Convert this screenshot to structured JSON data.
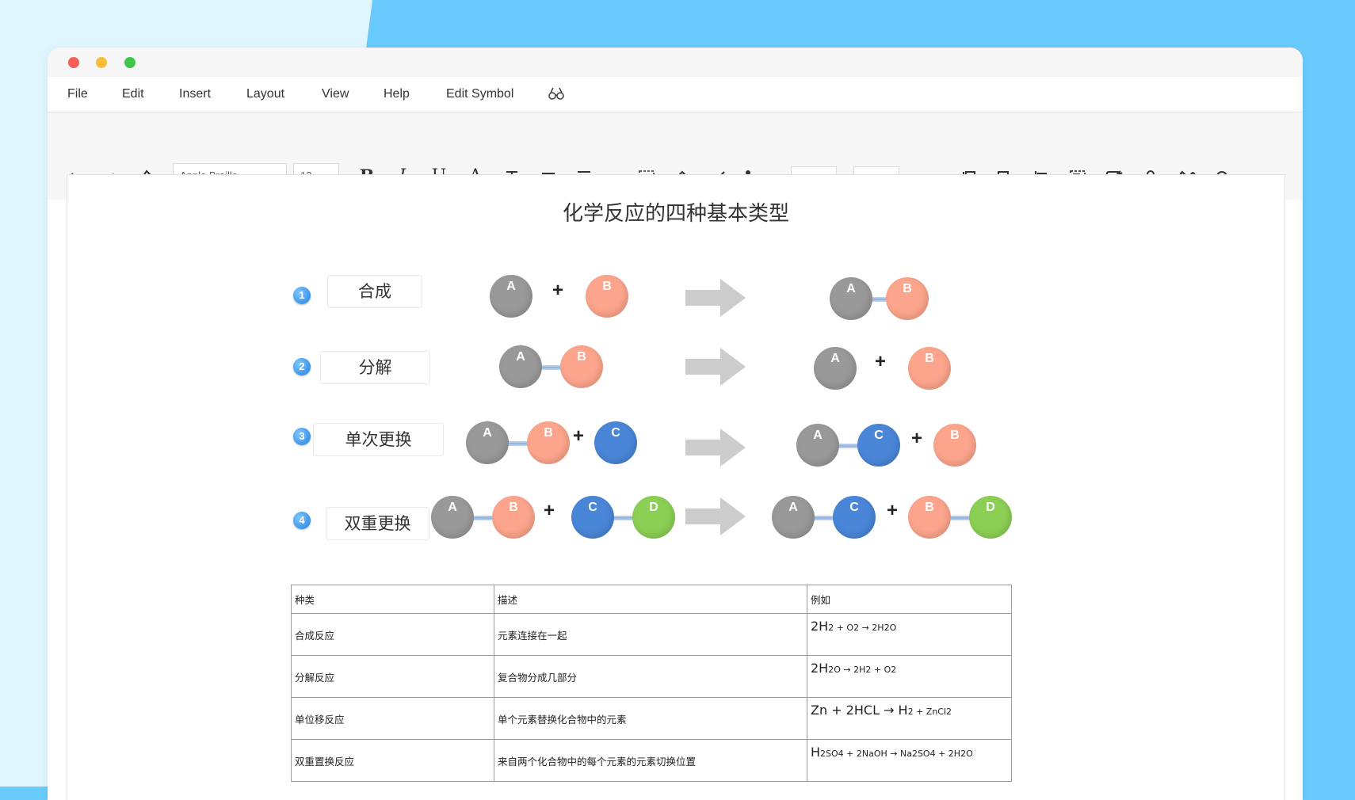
{
  "menu": [
    "File",
    "Edit",
    "Insert",
    "Layout",
    "View",
    "Help",
    "Edit Symbol"
  ],
  "toolbar": {
    "font_name": "Apple Braille",
    "font_size": "12",
    "bold_label": "B",
    "italic_label": "I",
    "underline_label": "U",
    "font_color_label": "A"
  },
  "title": "化学反应的四种基本类型",
  "reactions": [
    {
      "num": "1",
      "label": "合成"
    },
    {
      "num": "2",
      "label": "分解"
    },
    {
      "num": "3",
      "label": "单次更换"
    },
    {
      "num": "4",
      "label": "双重更换"
    }
  ],
  "atoms": {
    "a": "A",
    "b": "B",
    "c": "C",
    "d": "D"
  },
  "plus": "+",
  "table": {
    "headers": [
      "种类",
      "描述",
      "例如"
    ],
    "rows": [
      {
        "type": "合成反应",
        "desc": "元素连接在一起",
        "ex_main": "2H",
        "ex_rest": "2 + O2 → 2H2O"
      },
      {
        "type": "分解反应",
        "desc": "复合物分成几部分",
        "ex_main": "2H",
        "ex_rest": "2O → 2H2 + O2"
      },
      {
        "type": "单位移反应",
        "desc": "单个元素替换化合物中的元素",
        "ex_main": "Zn + 2HCL → H",
        "ex_rest": "2 + ZnCl2"
      },
      {
        "type": "双重置换反应",
        "desc": "来自两个化合物中的每个元素的元素切换位置",
        "ex_main": "H",
        "ex_rest": "2SO4 + 2NaOH → Na2SO4 + 2H2O"
      }
    ]
  },
  "colors": {
    "atom_a": "#999999",
    "atom_b": "#fca58c",
    "atom_c": "#4a86d8",
    "atom_d": "#8ccf55"
  }
}
